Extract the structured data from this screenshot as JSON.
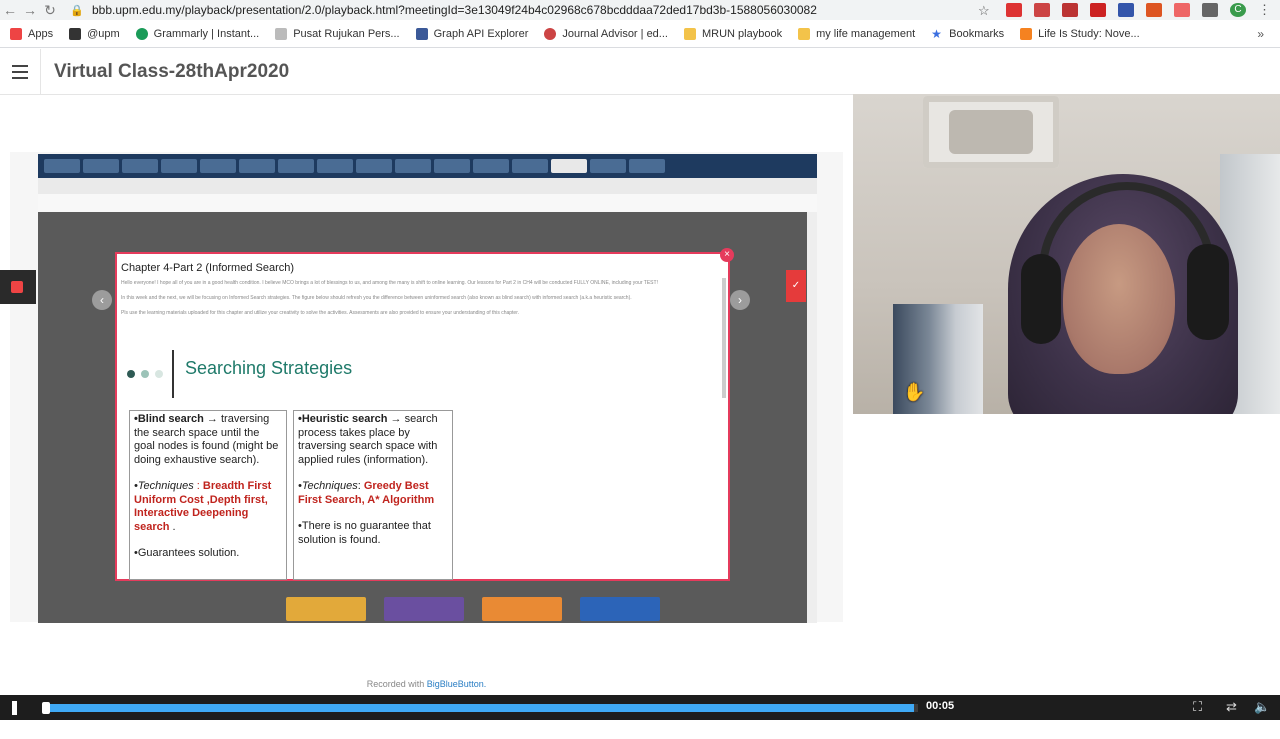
{
  "browser": {
    "url": "bbb.upm.edu.my/playback/presentation/2.0/playback.html?meetingId=3e13049f24b4c02968c678bcdddaa72ded17bd3b-1588056030082",
    "bookmarks": [
      "Apps",
      "@upm",
      "Grammarly | Instant...",
      "Pusat Rujukan Pers...",
      "Graph API Explorer",
      "Journal Advisor | ed...",
      "MRUN playbook",
      "my life management",
      "Bookmarks",
      "Life Is Study: Nove..."
    ],
    "bookmark_colors": [
      "#e44",
      "#333",
      "#1a9b58",
      "#999",
      "#3b5998",
      "#c44",
      "#f3c34a",
      "#f3c34a",
      "#3b6fe0",
      "#f58220"
    ],
    "profile_initial": "C"
  },
  "app": {
    "title": "Virtual Class-28thApr2020"
  },
  "slide": {
    "modal_title": "Chapter 4-Part 2 (Informed Search)",
    "intro": [
      "Hello everyone! I hope all of you are in a good health condition. I believe MCO brings a lot of blessings to us, and among the many is shift to online learning. Our lessons for Part 2 in CH4 will be conducted FULLY ONLINE, including your TEST!",
      "In this week and the next, we will be focusing on Informed Search strategies. The figure below should refresh you the difference between uninformed search (also known as blind search) with informed search (a.k.a heuristic search).",
      "Pls use the learning materials uploaded for this chapter and utilize your creativity to solve the activities. Assessments are also provided to ensure your understanding of this chapter."
    ],
    "heading": "Searching Strategies",
    "blind": {
      "title": "•Blind search",
      "desc": " → traversing the search space until the goal nodes is found (might be doing exhaustive search).",
      "tech_label": "•Techniques",
      "tech_sep": " : ",
      "tech_values": "Breadth First Uniform Cost  ,Depth first, Interactive Deepening search",
      "tail": " .",
      "guarantee": "•Guarantees solution."
    },
    "heuristic": {
      "title": "•Heuristic search",
      "desc": " → search process takes place by traversing search space with applied rules (information).",
      "tech_label": "•Techniques",
      "tech_sep": ": ",
      "tech_values": "Greedy Best First Search, A* Algorithm",
      "guarantee": "•There is no guarantee that solution is found."
    }
  },
  "footer": {
    "recorded_text": "Recorded with ",
    "recorded_link": "BigBlueButton."
  },
  "player": {
    "time": "00:05",
    "progress_fraction": 0.995
  }
}
